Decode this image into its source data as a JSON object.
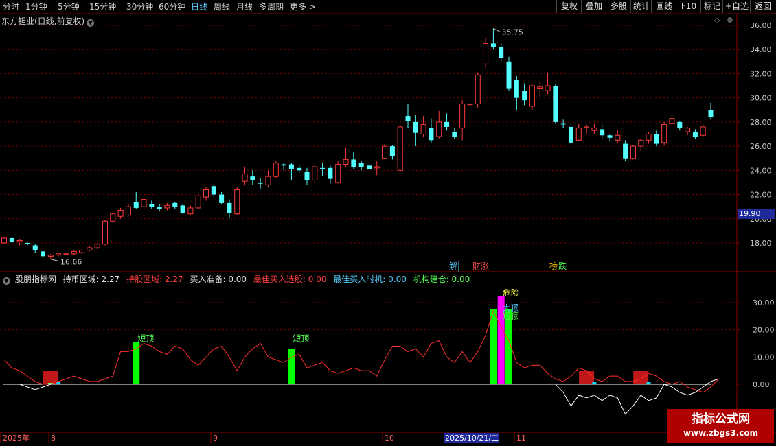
{
  "toolbar": {
    "periods": [
      "分时",
      "1分钟",
      "5分钟",
      "15分钟",
      "30分钟",
      "60分钟",
      "日线",
      "周线",
      "月线",
      "多周期",
      "更多 >"
    ],
    "active_period": "日线",
    "buttons": [
      "复权",
      "叠加",
      "多股",
      "统计",
      "画线",
      "F10",
      "+自选",
      "返回"
    ],
    "right_tab": "标记"
  },
  "stock": {
    "title": "东方钽业(日线,前复权)",
    "high_label": "35.75",
    "low_label": "16.66",
    "current_price_marker": "19.90"
  },
  "price_axis": [
    "36.00",
    "34.00",
    "32.00",
    "30.00",
    "28.00",
    "26.00",
    "24.00",
    "22.00",
    "20.00",
    "18.00"
  ],
  "indicator_axis": [
    "30.00",
    "20.00",
    "10.00",
    "0.00"
  ],
  "event_tags": [
    {
      "text": "解",
      "color": "#58d0ff"
    },
    {
      "text": "财",
      "color": "#ff5050"
    },
    {
      "text": "涨",
      "color": "#ff5050"
    },
    {
      "text": "榜",
      "color": "#ffd000"
    },
    {
      "text": "跌",
      "color": "#58ff58"
    }
  ],
  "indicator": {
    "name": "股朋指标网",
    "fields": [
      {
        "label": "持币区域: 2.27",
        "color": "#e0e0e0"
      },
      {
        "label": "持股区域: 2.27",
        "color": "#ff4040"
      },
      {
        "label": "买入准备: 0.00",
        "color": "#e0e0e0"
      },
      {
        "label": "最佳买入选股: 0.00",
        "color": "#ff4040"
      },
      {
        "label": "最佳买入时机: 0.00",
        "color": "#58d0ff"
      },
      {
        "label": "机构建仓: 0.00",
        "color": "#58ff58"
      }
    ],
    "annotations": {
      "short_top": "短顶",
      "danger": "危险",
      "big_top": "大顶"
    }
  },
  "time_axis": {
    "labels": [
      "2025年",
      "8",
      "9",
      "10",
      "2025/10/21/二",
      "11"
    ]
  },
  "watermark": {
    "cn": "指标公式网",
    "url": "www.zbgs3.com"
  },
  "chart_data": [
    {
      "type": "candlestick",
      "title": "东方钽业(日线,前复权)",
      "ylim": [
        16,
        37
      ],
      "candles": [
        {
          "o": 18.0,
          "c": 18.4,
          "h": 18.5,
          "l": 17.9
        },
        {
          "o": 18.4,
          "c": 18.1,
          "h": 18.5,
          "l": 18.0
        },
        {
          "o": 18.1,
          "c": 18.2,
          "h": 18.3,
          "l": 17.8
        },
        {
          "o": 18.0,
          "c": 17.9,
          "h": 18.1,
          "l": 17.8
        },
        {
          "o": 17.8,
          "c": 17.4,
          "h": 17.9,
          "l": 17.2
        },
        {
          "o": 17.3,
          "c": 16.9,
          "h": 17.4,
          "l": 16.7
        },
        {
          "o": 16.9,
          "c": 17.0,
          "h": 17.1,
          "l": 16.66
        },
        {
          "o": 17.0,
          "c": 17.1,
          "h": 17.2,
          "l": 16.9
        },
        {
          "o": 17.1,
          "c": 17.1,
          "h": 17.2,
          "l": 17.0
        },
        {
          "o": 17.1,
          "c": 17.3,
          "h": 17.4,
          "l": 17.0
        },
        {
          "o": 17.2,
          "c": 17.4,
          "h": 17.5,
          "l": 17.1
        },
        {
          "o": 17.4,
          "c": 17.6,
          "h": 17.7,
          "l": 17.3
        },
        {
          "o": 17.6,
          "c": 17.9,
          "h": 18.0,
          "l": 17.5
        },
        {
          "o": 17.9,
          "c": 19.8,
          "h": 19.9,
          "l": 17.8
        },
        {
          "o": 19.8,
          "c": 20.4,
          "h": 20.6,
          "l": 19.7
        },
        {
          "o": 20.2,
          "c": 20.7,
          "h": 20.9,
          "l": 20.0
        },
        {
          "o": 20.3,
          "c": 21.0,
          "h": 21.2,
          "l": 20.2
        },
        {
          "o": 21.4,
          "c": 20.9,
          "h": 22.2,
          "l": 20.8
        },
        {
          "o": 21.0,
          "c": 21.6,
          "h": 22.0,
          "l": 20.7
        },
        {
          "o": 21.2,
          "c": 21.0,
          "h": 21.5,
          "l": 20.8
        },
        {
          "o": 21.0,
          "c": 20.8,
          "h": 21.2,
          "l": 20.6
        },
        {
          "o": 20.9,
          "c": 21.1,
          "h": 21.3,
          "l": 20.7
        },
        {
          "o": 21.3,
          "c": 21.0,
          "h": 21.4,
          "l": 20.8
        },
        {
          "o": 21.1,
          "c": 20.5,
          "h": 21.2,
          "l": 20.4
        },
        {
          "o": 20.4,
          "c": 20.9,
          "h": 21.1,
          "l": 20.3
        },
        {
          "o": 20.9,
          "c": 21.9,
          "h": 22.0,
          "l": 20.8
        },
        {
          "o": 21.8,
          "c": 22.4,
          "h": 22.6,
          "l": 21.5
        },
        {
          "o": 22.7,
          "c": 22.0,
          "h": 22.9,
          "l": 21.8
        },
        {
          "o": 22.0,
          "c": 21.3,
          "h": 22.2,
          "l": 21.2
        },
        {
          "o": 21.3,
          "c": 20.5,
          "h": 21.6,
          "l": 20.1
        },
        {
          "o": 20.4,
          "c": 22.4,
          "h": 22.6,
          "l": 20.3
        },
        {
          "o": 23.1,
          "c": 23.7,
          "h": 24.3,
          "l": 22.8
        },
        {
          "o": 23.5,
          "c": 23.2,
          "h": 24.0,
          "l": 22.8
        },
        {
          "o": 23.0,
          "c": 22.9,
          "h": 23.4,
          "l": 22.5
        },
        {
          "o": 22.8,
          "c": 23.5,
          "h": 24.0,
          "l": 22.6
        },
        {
          "o": 23.5,
          "c": 24.6,
          "h": 24.8,
          "l": 23.4
        },
        {
          "o": 24.5,
          "c": 24.4,
          "h": 24.6,
          "l": 24.0
        },
        {
          "o": 24.5,
          "c": 24.1,
          "h": 24.6,
          "l": 23.2
        },
        {
          "o": 24.2,
          "c": 24.0,
          "h": 24.5,
          "l": 23.8
        },
        {
          "o": 23.9,
          "c": 23.2,
          "h": 24.2,
          "l": 22.8
        },
        {
          "o": 23.2,
          "c": 24.3,
          "h": 24.5,
          "l": 23.0
        },
        {
          "o": 24.2,
          "c": 24.1,
          "h": 24.6,
          "l": 23.5
        },
        {
          "o": 24.2,
          "c": 23.3,
          "h": 24.4,
          "l": 22.9
        },
        {
          "o": 23.0,
          "c": 24.5,
          "h": 24.8,
          "l": 22.9
        },
        {
          "o": 24.5,
          "c": 24.9,
          "h": 25.9,
          "l": 24.3
        },
        {
          "o": 24.9,
          "c": 24.3,
          "h": 25.5,
          "l": 24.1
        },
        {
          "o": 24.6,
          "c": 24.3,
          "h": 24.8,
          "l": 24.0
        },
        {
          "o": 24.4,
          "c": 24.1,
          "h": 24.7,
          "l": 23.9
        },
        {
          "o": 24.2,
          "c": 24.3,
          "h": 24.8,
          "l": 23.6
        },
        {
          "o": 25.0,
          "c": 26.0,
          "h": 26.2,
          "l": 24.9
        },
        {
          "o": 26.0,
          "c": 25.2,
          "h": 26.1,
          "l": 24.9
        },
        {
          "o": 24.0,
          "c": 27.6,
          "h": 27.8,
          "l": 23.9
        },
        {
          "o": 28.5,
          "c": 28.1,
          "h": 29.5,
          "l": 27.5
        },
        {
          "o": 28.0,
          "c": 27.1,
          "h": 28.6,
          "l": 26.0
        },
        {
          "o": 27.0,
          "c": 27.8,
          "h": 28.5,
          "l": 26.8
        },
        {
          "o": 27.5,
          "c": 26.5,
          "h": 28.3,
          "l": 26.3
        },
        {
          "o": 26.8,
          "c": 28.0,
          "h": 28.9,
          "l": 26.6
        },
        {
          "o": 28.0,
          "c": 27.6,
          "h": 28.7,
          "l": 27.3
        },
        {
          "o": 27.2,
          "c": 26.8,
          "h": 27.5,
          "l": 26.6
        },
        {
          "o": 27.5,
          "c": 29.5,
          "h": 29.8,
          "l": 26.5
        },
        {
          "o": 29.5,
          "c": 29.5,
          "h": 29.8,
          "l": 29.3
        },
        {
          "o": 29.5,
          "c": 31.9,
          "h": 32.1,
          "l": 29.2
        },
        {
          "o": 32.8,
          "c": 34.5,
          "h": 35.0,
          "l": 32.5
        },
        {
          "o": 34.5,
          "c": 34.2,
          "h": 35.75,
          "l": 34.0
        },
        {
          "o": 34.2,
          "c": 33.3,
          "h": 34.5,
          "l": 33.0
        },
        {
          "o": 33.0,
          "c": 30.8,
          "h": 33.4,
          "l": 30.6
        },
        {
          "o": 31.5,
          "c": 30.0,
          "h": 31.8,
          "l": 29.0
        },
        {
          "o": 30.6,
          "c": 29.8,
          "h": 31.2,
          "l": 29.4
        },
        {
          "o": 29.3,
          "c": 31.0,
          "h": 31.2,
          "l": 29.0
        },
        {
          "o": 30.8,
          "c": 30.9,
          "h": 31.4,
          "l": 30.1
        },
        {
          "o": 30.6,
          "c": 31.0,
          "h": 32.1,
          "l": 30.3
        },
        {
          "o": 31.0,
          "c": 28.0,
          "h": 31.1,
          "l": 27.9
        },
        {
          "o": 27.9,
          "c": 27.8,
          "h": 28.2,
          "l": 27.5
        },
        {
          "o": 27.6,
          "c": 26.3,
          "h": 27.8,
          "l": 26.1
        },
        {
          "o": 26.5,
          "c": 27.5,
          "h": 27.9,
          "l": 26.4
        },
        {
          "o": 27.6,
          "c": 27.6,
          "h": 27.8,
          "l": 27.0
        },
        {
          "o": 27.3,
          "c": 27.5,
          "h": 27.9,
          "l": 27.0
        },
        {
          "o": 27.4,
          "c": 26.9,
          "h": 27.8,
          "l": 26.6
        },
        {
          "o": 26.9,
          "c": 26.7,
          "h": 27.0,
          "l": 26.4
        },
        {
          "o": 26.5,
          "c": 26.9,
          "h": 27.3,
          "l": 26.3
        },
        {
          "o": 26.2,
          "c": 25.0,
          "h": 26.5,
          "l": 24.8
        },
        {
          "o": 25.0,
          "c": 26.0,
          "h": 26.1,
          "l": 24.9
        },
        {
          "o": 26.0,
          "c": 26.5,
          "h": 26.6,
          "l": 25.6
        },
        {
          "o": 26.5,
          "c": 27.0,
          "h": 27.2,
          "l": 26.2
        },
        {
          "o": 27.0,
          "c": 26.2,
          "h": 27.3,
          "l": 26.0
        },
        {
          "o": 26.3,
          "c": 27.8,
          "h": 28.0,
          "l": 26.1
        },
        {
          "o": 27.9,
          "c": 28.3,
          "h": 28.6,
          "l": 27.6
        },
        {
          "o": 28.0,
          "c": 27.5,
          "h": 28.1,
          "l": 27.3
        },
        {
          "o": 27.2,
          "c": 27.5,
          "h": 27.6,
          "l": 26.9
        },
        {
          "o": 27.2,
          "c": 26.8,
          "h": 27.4,
          "l": 26.6
        },
        {
          "o": 26.9,
          "c": 27.6,
          "h": 27.9,
          "l": 26.8
        },
        {
          "o": 29.0,
          "c": 28.4,
          "h": 29.6,
          "l": 28.2
        }
      ]
    },
    {
      "type": "line",
      "title": "股朋指标网",
      "ylim": [
        -12,
        34
      ],
      "series": [
        {
          "name": "持股区域",
          "color": "#ff3030",
          "values": [
            9,
            6,
            5,
            3,
            1,
            0,
            0,
            1,
            2,
            3,
            2,
            1,
            1,
            2,
            3,
            12,
            12,
            13,
            15,
            14,
            12,
            11,
            14,
            13,
            9,
            7,
            10,
            13,
            14,
            10,
            5,
            10,
            13,
            15,
            10,
            9,
            8,
            10,
            11,
            6,
            7,
            8,
            5,
            4,
            5,
            6,
            5,
            5,
            3,
            9,
            14,
            14,
            12,
            13,
            10,
            15,
            16,
            10,
            8,
            12,
            8,
            12,
            18,
            27,
            21,
            16,
            8,
            6,
            7,
            7,
            4,
            2,
            1,
            3,
            6,
            5,
            2,
            1,
            3,
            3,
            1,
            1,
            2,
            4,
            3,
            1,
            0,
            1,
            -1,
            -2,
            -3,
            -1,
            2
          ]
        },
        {
          "name": "持币区域",
          "color": "#ffffff",
          "values": [
            0,
            0,
            0,
            -1,
            -2,
            -1,
            0,
            0,
            0,
            0,
            0,
            0,
            0,
            0,
            0,
            0,
            0,
            0,
            0,
            0,
            0,
            0,
            0,
            0,
            0,
            0,
            0,
            0,
            0,
            0,
            0,
            0,
            0,
            0,
            0,
            0,
            0,
            0,
            0,
            0,
            0,
            0,
            0,
            0,
            0,
            0,
            0,
            0,
            0,
            0,
            0,
            0,
            0,
            0,
            0,
            0,
            0,
            0,
            0,
            0,
            0,
            0,
            0,
            0,
            0,
            0,
            0,
            0,
            0,
            0,
            0,
            0,
            -3,
            -8,
            -4,
            -5,
            -4,
            -6,
            -4,
            -5,
            -11,
            -8,
            -4,
            -6,
            -5,
            0,
            -1,
            -3,
            -4,
            -3,
            -1,
            1,
            2
          ]
        }
      ],
      "bars": [
        {
          "index": 6,
          "color": "#58ff58",
          "value": 0.5
        },
        {
          "index": 17,
          "color": "#00ff00",
          "value": 15.5
        },
        {
          "index": 37,
          "color": "#00ff00",
          "value": 13
        },
        {
          "index": 63,
          "color": "#00ff00",
          "value": 27.5
        },
        {
          "index": 64,
          "color": "#ff00ff",
          "value": 32.5
        },
        {
          "index": 65,
          "color": "#00ff00",
          "value": 27.5
        }
      ],
      "blocks": [
        {
          "index": 6,
          "color": "#c01818",
          "value": 5
        },
        {
          "index": 75,
          "color": "#c01818",
          "value": 5
        },
        {
          "index": 82,
          "color": "#c01818",
          "value": 5
        }
      ],
      "labels": [
        {
          "index": 17,
          "text": "短顶"
        },
        {
          "index": 37,
          "text": "短顶"
        }
      ]
    }
  ]
}
